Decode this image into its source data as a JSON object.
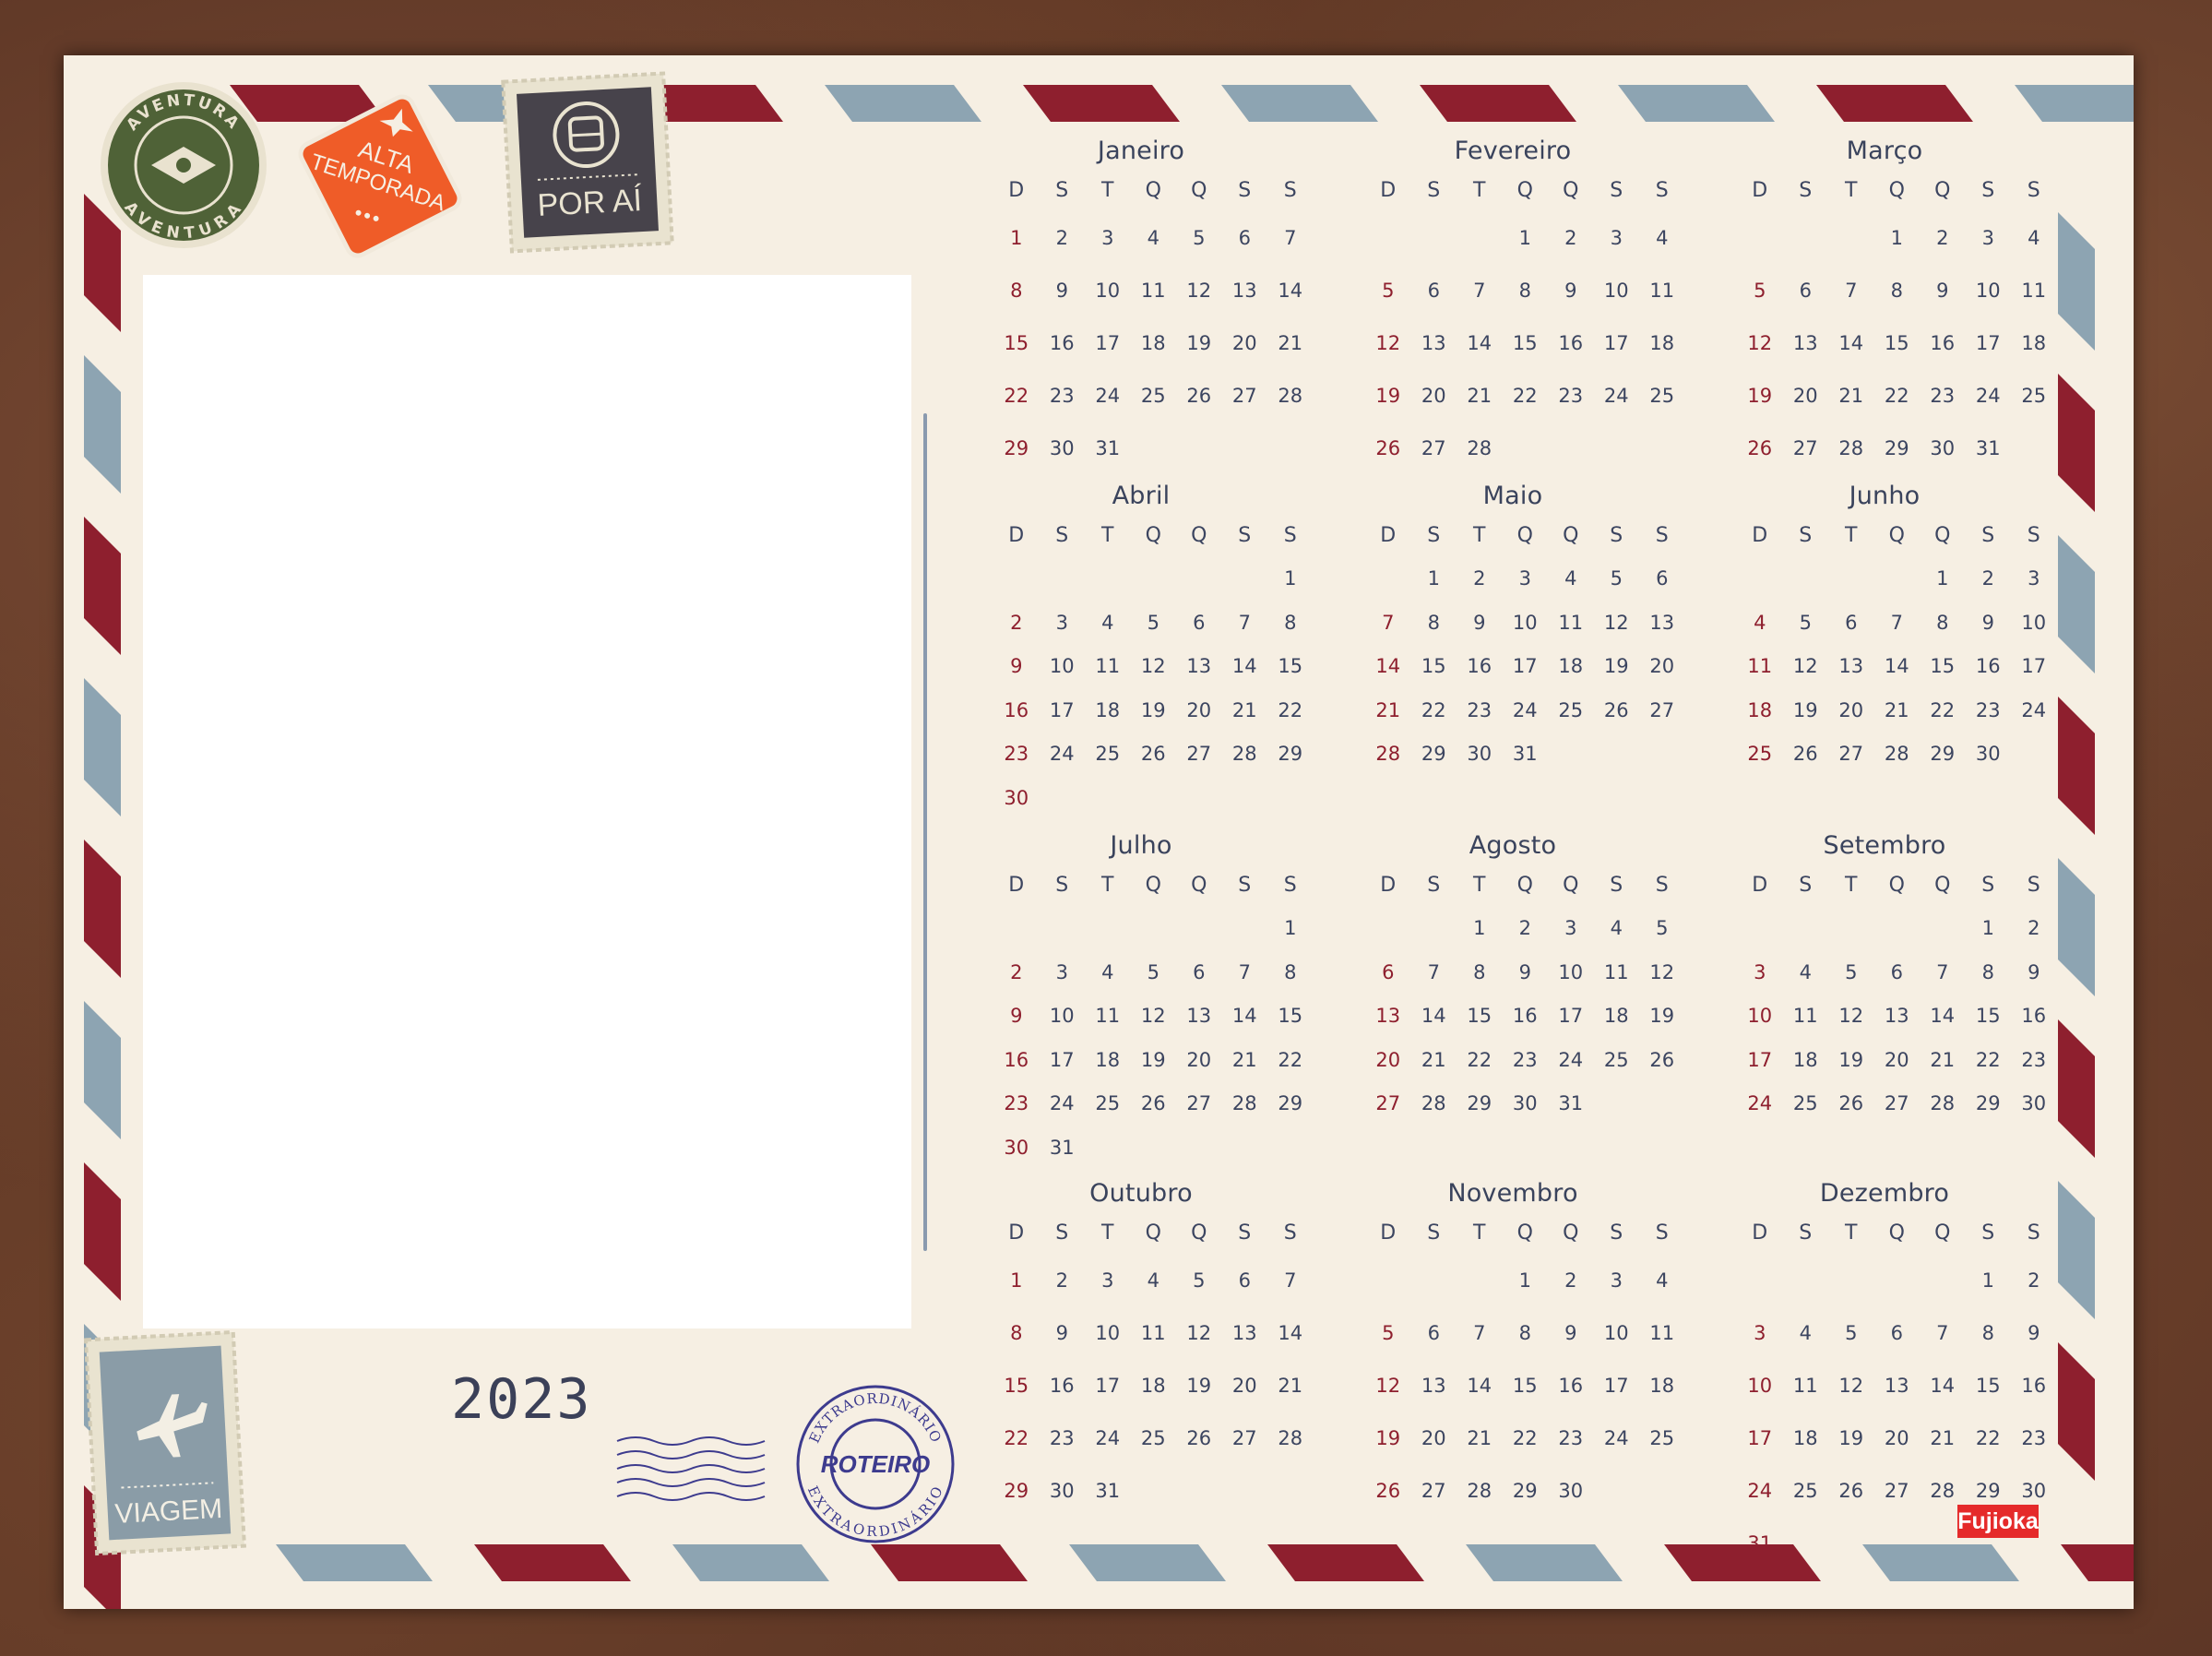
{
  "year": "2023",
  "brand": "Fujioka",
  "stamps": {
    "aventura_top": "AVENTURA",
    "aventura_bottom": "AVENTURA",
    "alta_line1": "ALTA",
    "alta_line2": "TEMPORADA",
    "por_ai": "POR AÍ",
    "viagem": "VIAGEM",
    "roteiro": "ROTEIRO",
    "extraordinario": "EXTRAORDINÁRIO"
  },
  "weekdays": [
    "D",
    "S",
    "T",
    "Q",
    "Q",
    "S",
    "S"
  ],
  "colors": {
    "paper": "#f6efe3",
    "airmail_red": "#8e1f2e",
    "airmail_blue": "#8da4b2",
    "text": "#3c4560",
    "sunday": "#8e1f2e",
    "brand": "#e52a2a"
  },
  "months": [
    {
      "name": "Janeiro",
      "start": 0,
      "days": 31
    },
    {
      "name": "Fevereiro",
      "start": 3,
      "days": 28
    },
    {
      "name": "Março",
      "start": 3,
      "days": 31
    },
    {
      "name": "Abril",
      "start": 6,
      "days": 30
    },
    {
      "name": "Maio",
      "start": 1,
      "days": 31
    },
    {
      "name": "Junho",
      "start": 4,
      "days": 30
    },
    {
      "name": "Julho",
      "start": 6,
      "days": 31
    },
    {
      "name": "Agosto",
      "start": 2,
      "days": 31
    },
    {
      "name": "Setembro",
      "start": 5,
      "days": 30
    },
    {
      "name": "Outubro",
      "start": 0,
      "days": 31
    },
    {
      "name": "Novembro",
      "start": 3,
      "days": 30
    },
    {
      "name": "Dezembro",
      "start": 5,
      "days": 31
    }
  ]
}
